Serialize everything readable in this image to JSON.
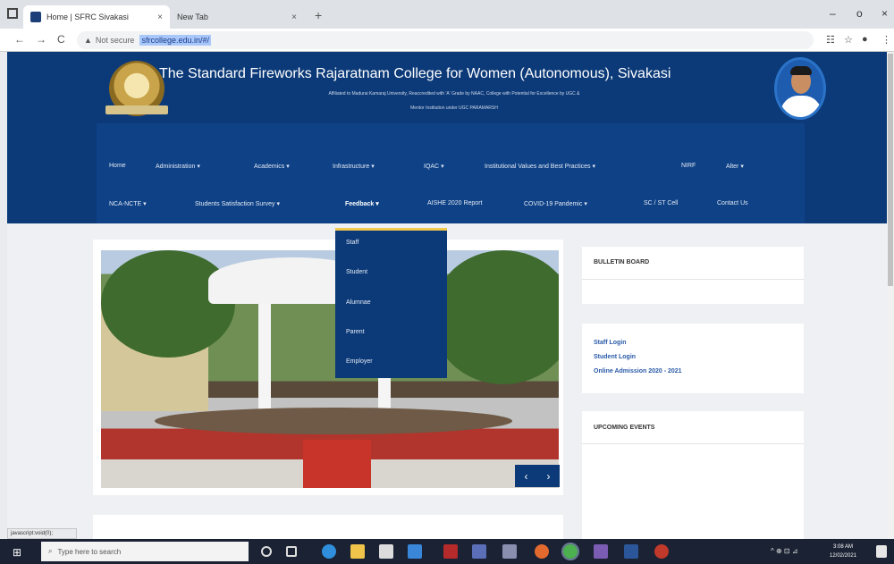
{
  "browser": {
    "tabs": [
      {
        "label": "Home | SFRC Sivakasi",
        "close": "×"
      },
      {
        "label": "New Tab",
        "close": "×"
      }
    ],
    "new_tab": "+",
    "window_controls": [
      "–",
      "o",
      "×"
    ],
    "nav": {
      "back": "←",
      "forward": "→",
      "reload": "C"
    },
    "address": {
      "warning": "▲",
      "security_label": "Not secure",
      "url": "sfrcollege.edu.in/#/"
    },
    "right_icons": [
      "☷",
      "☆",
      "●",
      "⋮"
    ],
    "status_text": "javascript:void(0);"
  },
  "header": {
    "title": "The Standard Fireworks Rajaratnam College for Women (Autonomous), Sivakasi",
    "subtitle_line1": "Affiliated to Madurai Kamaraj University, Reaccredited with 'A' Grade by NAAC, College with Potential for Excellence by UGC &",
    "subtitle_line2": "Mentor Institution under UGC PARAMARSH"
  },
  "nav": {
    "row1": [
      {
        "label": "Home",
        "caret": false
      },
      {
        "label": "Administration",
        "caret": true
      },
      {
        "label": "Academics",
        "caret": true
      },
      {
        "label": "Infrastructure",
        "caret": true
      },
      {
        "label": "IQAC",
        "caret": true
      },
      {
        "label": "Institutional Values and Best Practices",
        "caret": true
      },
      {
        "label": "NIRF",
        "caret": false
      },
      {
        "label": "Alter",
        "caret": true
      }
    ],
    "row2": [
      {
        "label": "NCA-NCTE",
        "caret": true
      },
      {
        "label": "Students Satisfaction Survey",
        "caret": true
      },
      {
        "label": "Feedback",
        "caret": true
      },
      {
        "label": "AISHE 2020 Report",
        "caret": false
      },
      {
        "label": "COVID-19 Pandemic",
        "caret": true
      },
      {
        "label": "SC / ST Cell",
        "caret": false
      },
      {
        "label": "Contact Us",
        "caret": false
      }
    ],
    "caret_glyph": "▾"
  },
  "feedback_menu": [
    "Staff",
    "Student",
    "Alumnae",
    "Parent",
    "Employer"
  ],
  "slider": {
    "prev": "‹",
    "next": "›"
  },
  "sidebar": {
    "bulletin_title": "BULLETIN BOARD",
    "links": [
      "Staff Login",
      "Student Login",
      "Online Admission 2020 - 2021"
    ],
    "events_title": "UPCOMING EVENTS"
  },
  "taskbar": {
    "start": "⊞",
    "search_icon": "⌕",
    "search_placeholder": "Type here to search",
    "tray": "^ ⊕ ⊡ ⊿",
    "time": "3:08 AM",
    "date": "12/02/2021"
  },
  "colors": {
    "header_bg": "#0c3a78",
    "accent": "#f2c94c",
    "link": "#2a5aa8"
  }
}
